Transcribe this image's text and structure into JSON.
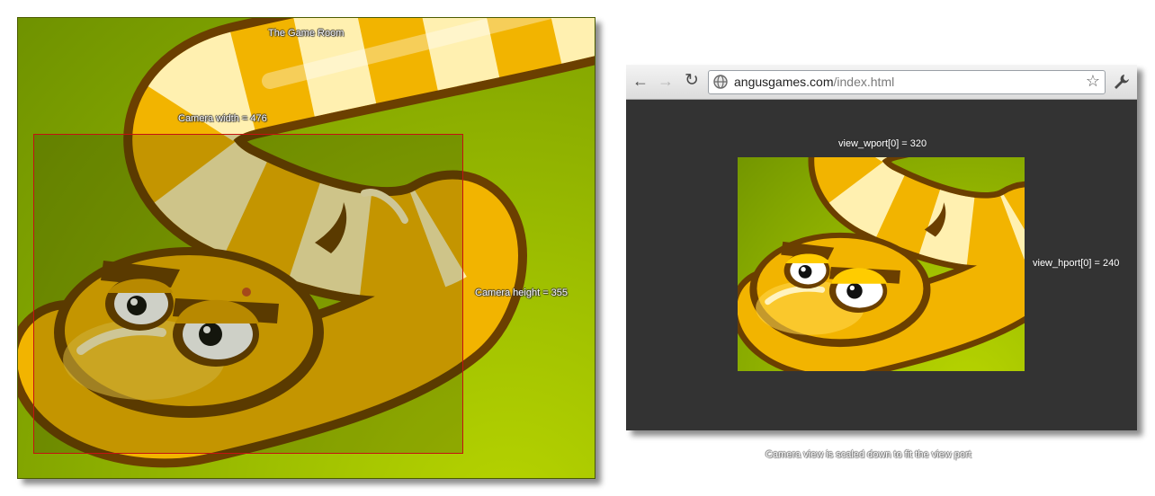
{
  "room": {
    "title": "The Game Room",
    "camera_width_label": "Camera width = 476",
    "camera_height_label": "Camera height = 355"
  },
  "browser": {
    "url_host": "angusgames.com",
    "url_path": "/index.html",
    "viewport_width_label": "view_wport[0] = 320",
    "viewport_height_label": "view_hport[0] = 240"
  },
  "caption": "Camera view is scaled down to fit the view port",
  "icons": {
    "back": "back-arrow-icon",
    "forward": "forward-arrow-icon",
    "reload": "reload-icon",
    "site": "globe-icon",
    "bookmark": "star-icon",
    "menu": "wrench-icon"
  },
  "colors": {
    "camera_border": "#c41212",
    "grass": "#8fb000",
    "snake_body": "#e0a800",
    "browser_bg": "#333333"
  }
}
